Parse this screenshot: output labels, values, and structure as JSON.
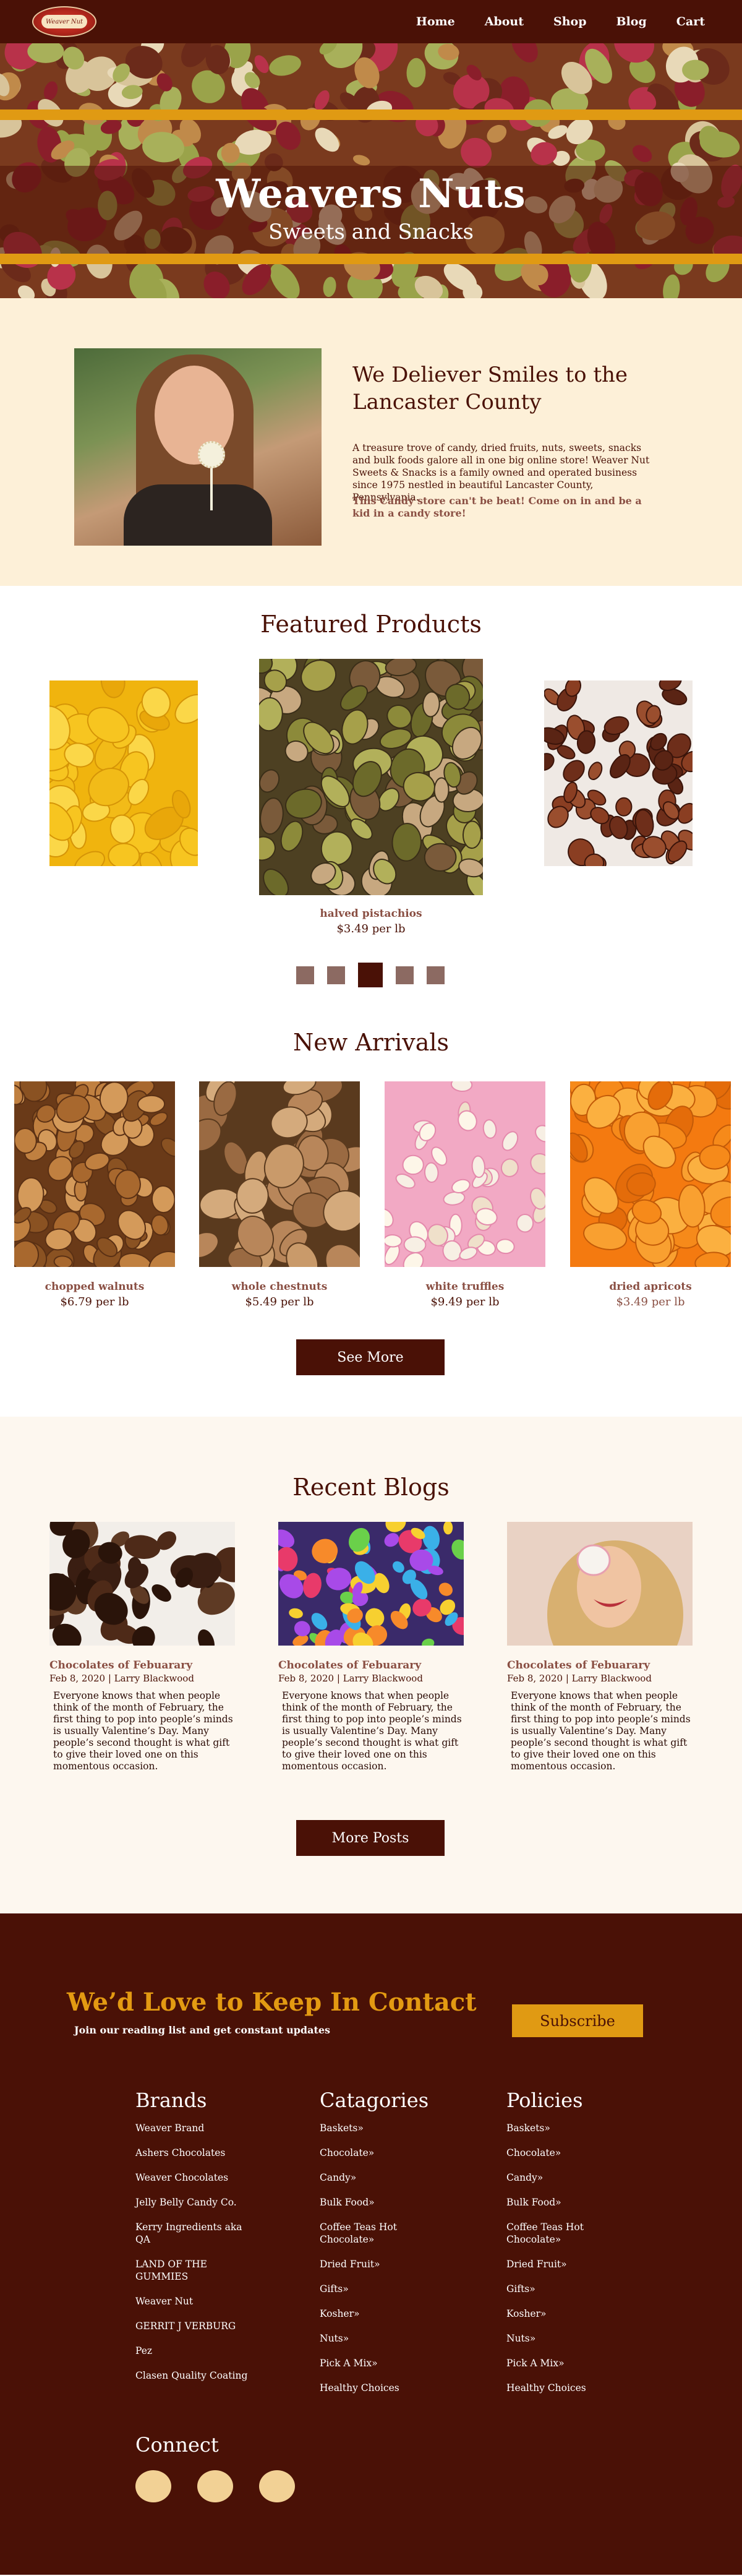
{
  "nav": {
    "logo_text": "Weaver Nut",
    "links": [
      {
        "label": "Home"
      },
      {
        "label": "About"
      },
      {
        "label": "Shop"
      },
      {
        "label": "Blog"
      },
      {
        "label": "Cart"
      }
    ]
  },
  "hero": {
    "title": "Weavers Nuts",
    "subtitle": "Sweets and Snacks"
  },
  "intro": {
    "heading": "We Deliever Smiles to the Lancaster County",
    "paragraph": " A treasure trove of candy, dried fruits, nuts, sweets, snacks and bulk foods galore all in one big online store! Weaver Nut Sweets & Snacks is a family owned and operated business since 1975 nestled in beautiful Lancaster County, Pennsylvania.",
    "tagline": "This Candy store can't be beat!  Come on in and be a kid in a candy store!"
  },
  "featured": {
    "title": "Featured Products",
    "product_name": "halved pistachios",
    "product_price": "$3.49 per lb",
    "active_slide": 3,
    "slide_count": 5
  },
  "arrivals": {
    "title": "New Arrivals",
    "items": [
      {
        "name": "chopped walnuts",
        "price": "$6.79 per lb"
      },
      {
        "name": "whole chestnuts",
        "price": "$5.49 per lb"
      },
      {
        "name": "white truffles",
        "price": "$9.49 per lb"
      },
      {
        "name": "dried apricots",
        "price": "$3.49 per lb"
      }
    ],
    "button": "See More"
  },
  "blogs": {
    "title": "Recent Blogs",
    "posts": [
      {
        "title": "Chocolates of Febuarary",
        "meta": "Feb 8, 2020 | Larry Blackwood",
        "body": "Everyone knows that when people think of the month of February, the first thing to pop into people’s minds is usually Valentine’s Day. Many people’s second thought is what gift to give their loved one on this momentous occasion."
      },
      {
        "title": "Chocolates of Febuarary",
        "meta": "Feb 8, 2020 | Larry Blackwood",
        "body": "Everyone knows that when people think of the month of February, the first thing to pop into people’s minds is usually Valentine’s Day. Many people’s second thought is what gift to give their loved one on this momentous occasion."
      },
      {
        "title": "Chocolates of Febuarary",
        "meta": "Feb 8, 2020 | Larry Blackwood",
        "body": "Everyone knows that when people think of the month of February, the first thing to pop into people’s minds is usually Valentine’s Day. Many people’s second thought is what gift to give their loved one on this momentous occasion."
      }
    ],
    "button": "More Posts"
  },
  "footer": {
    "contact_title": "We’d Love to Keep In Contact",
    "contact_sub": "Join our reading list and get constant updates",
    "subscribe": "Subscribe",
    "brands": {
      "title": "Brands",
      "items": [
        "Weaver Brand",
        "Ashers Chocolates",
        "Weaver Chocolates",
        "Jelly Belly Candy Co.",
        "Kerry Ingredients aka QA",
        "LAND OF THE GUMMIES",
        "Weaver Nut",
        "GERRIT J VERBURG",
        "Pez",
        "Clasen Quality Coating"
      ]
    },
    "categories": {
      "title": "Catagories",
      "items": [
        "Baskets»",
        "Chocolate»",
        "Candy»",
        "Bulk Food»",
        "Coffee Teas Hot Chocolate»",
        "Dried Fruit»",
        "Gifts»",
        "Kosher»",
        "Nuts»",
        "Pick A Mix»",
        "Healthy Choices"
      ]
    },
    "policies": {
      "title": "Policies",
      "items": [
        "Baskets»",
        "Chocolate»",
        "Candy»",
        "Bulk Food»",
        "Coffee Teas Hot Chocolate»",
        "Dried Fruit»",
        "Gifts»",
        "Kosher»",
        "Nuts»",
        "Pick A Mix»",
        "Healthy Choices"
      ]
    },
    "connect_title": "Connect",
    "social_icons": [
      "social-icon-1",
      "social-icon-2",
      "social-icon-3"
    ]
  },
  "colors": {
    "brand_dark": "#4a1106",
    "accent_orange": "#e09a13",
    "cream": "#fdf0d8",
    "muted_link": "#8a4f43"
  }
}
